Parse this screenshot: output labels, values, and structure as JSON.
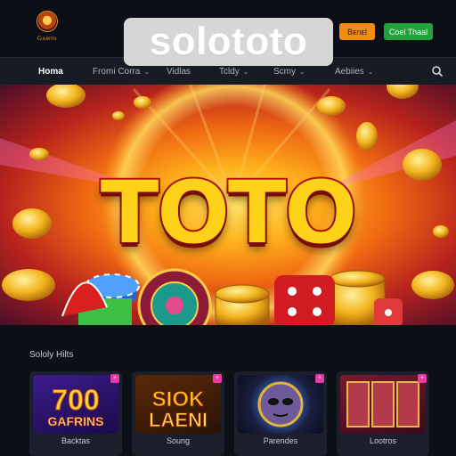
{
  "header": {
    "logo_text": "Gᴀᴍᴛᴏ",
    "brand": "solototo",
    "register_label": "Bᴇnᴇl",
    "login_label": "Coel Thaal"
  },
  "nav": {
    "items": [
      {
        "label": "Homa",
        "dropdown": false,
        "active": true
      },
      {
        "label": "Fromi Corra",
        "dropdown": true,
        "active": false
      },
      {
        "label": "Vidlas",
        "dropdown": false,
        "active": false
      },
      {
        "label": "Tcldy",
        "dropdown": true,
        "active": false
      },
      {
        "label": "Scmy",
        "dropdown": true,
        "active": false
      },
      {
        "label": "Aebiies",
        "dropdown": true,
        "active": false
      }
    ],
    "search_icon": "search-icon"
  },
  "hero": {
    "title": "TOTO"
  },
  "section": {
    "title": "Sololy Hilts",
    "cards": [
      {
        "art_text": "700\nGAFRINS",
        "label": "Backtas",
        "badge": "+",
        "accent": "#6a2fd1"
      },
      {
        "art_text": "SIOK\nLAENI",
        "label": "Soung",
        "badge": "+",
        "accent": "#f2a317"
      },
      {
        "art_text": "",
        "label": "Parendes",
        "badge": "+",
        "accent": "#2f7bd6"
      },
      {
        "art_text": "",
        "label": "Lootros",
        "badge": "+",
        "accent": "#c03b3b"
      }
    ]
  },
  "colors": {
    "accent_orange": "#ef8d14",
    "accent_green": "#1fa33a",
    "bg": "#0b0f16"
  }
}
